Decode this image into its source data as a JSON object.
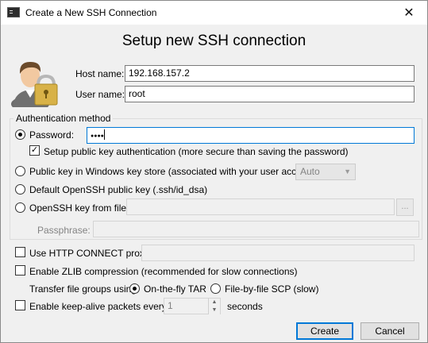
{
  "window": {
    "title": "Create a New SSH Connection",
    "heading": "Setup new SSH connection"
  },
  "host": {
    "label": "Host name:",
    "value": "192.168.157.2"
  },
  "user": {
    "label": "User name:",
    "value": "root"
  },
  "auth": {
    "legend": "Authentication method",
    "password": {
      "label": "Password:",
      "value": "●●●●",
      "selected": true
    },
    "setup_pubkey": {
      "label": "Setup public key authentication (more secure than saving the password)",
      "checked": true
    },
    "windows_store": {
      "label": "Public key in Windows key store (associated with your user account)",
      "combo_value": "Auto"
    },
    "default_openssh": {
      "label": "Default OpenSSH public key (.ssh/id_dsa)"
    },
    "openssh_file": {
      "label": "OpenSSH key from file:",
      "browse_label": "..."
    },
    "passphrase": {
      "label": "Passphrase:"
    }
  },
  "proxy": {
    "label": "Use HTTP CONNECT proxy:",
    "checked": false
  },
  "zlib": {
    "label": "Enable ZLIB compression (recommended for slow connections)",
    "checked": false
  },
  "transfer": {
    "label": "Transfer file groups using:",
    "options": [
      "On-the-fly TAR",
      "File-by-file SCP (slow)"
    ],
    "selected": "On-the-fly TAR"
  },
  "keepalive": {
    "label": "Enable keep-alive packets every:",
    "value": "1",
    "unit": "seconds",
    "checked": false
  },
  "buttons": {
    "create": "Create",
    "cancel": "Cancel"
  },
  "icons": {
    "close": "close-icon",
    "title": "terminal-icon",
    "avatar": "user-lock-icon"
  },
  "colors": {
    "focus": "#0078d7",
    "background": "#f0f0f0"
  }
}
